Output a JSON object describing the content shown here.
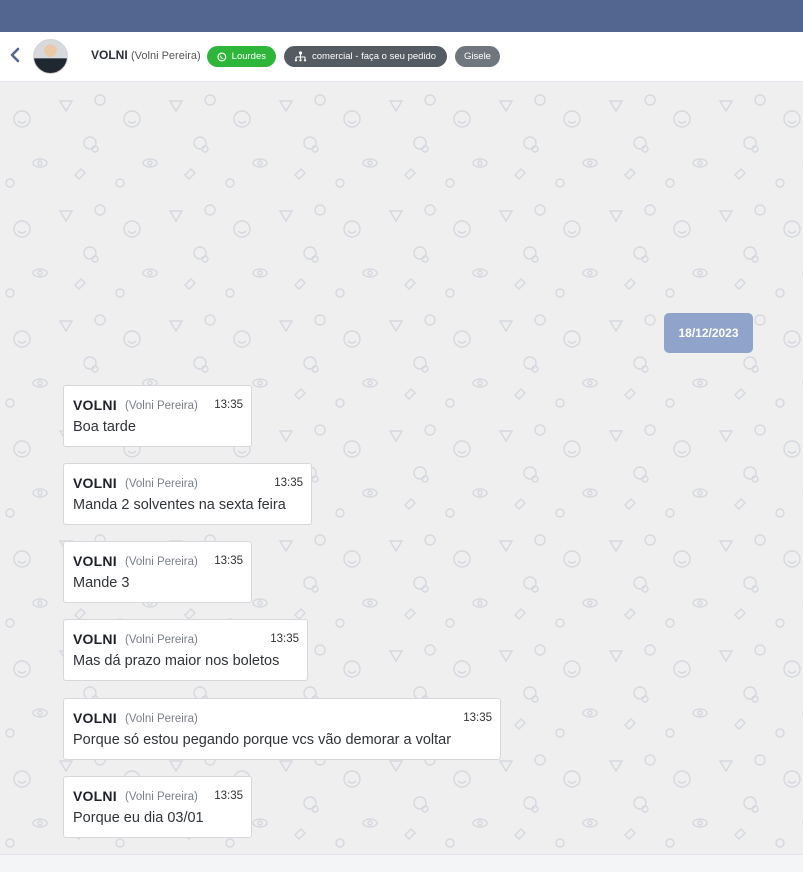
{
  "header": {
    "contact_name": "VOLNI",
    "contact_full_name": "(Volni Pereira)",
    "tags": {
      "whatsapp": "Lourdes",
      "department": "comercial - faça o seu pedido",
      "user": "Gisele"
    }
  },
  "chat": {
    "date_separator": "18/12/2023",
    "messages": [
      {
        "sender": "VOLNI",
        "full_name": "(Volni Pereira)",
        "time": "13:35",
        "text": "Boa tarde"
      },
      {
        "sender": "VOLNI",
        "full_name": "(Volni Pereira)",
        "time": "13:35",
        "text": "Manda 2 solventes na sexta feira"
      },
      {
        "sender": "VOLNI",
        "full_name": "(Volni Pereira)",
        "time": "13:35",
        "text": "Mande 3"
      },
      {
        "sender": "VOLNI",
        "full_name": "(Volni Pereira)",
        "time": "13:35",
        "text": "Mas dá prazo maior nos boletos"
      },
      {
        "sender": "VOLNI",
        "full_name": "(Volni Pereira)",
        "time": "13:35",
        "text": "Porque só estou pegando porque vcs vão demorar a voltar"
      },
      {
        "sender": "VOLNI",
        "full_name": "(Volni Pereira)",
        "time": "13:35",
        "text": "Porque eu dia 03/01"
      }
    ]
  },
  "colors": {
    "topbar": "#52668f",
    "whatsapp_tag": "#2db63a",
    "department_tag": "#555b63",
    "user_tag": "#6f767e",
    "date_chip": "#8fa3cb"
  },
  "icons": [
    "chevron-left-icon",
    "whatsapp-icon",
    "department-icon"
  ]
}
